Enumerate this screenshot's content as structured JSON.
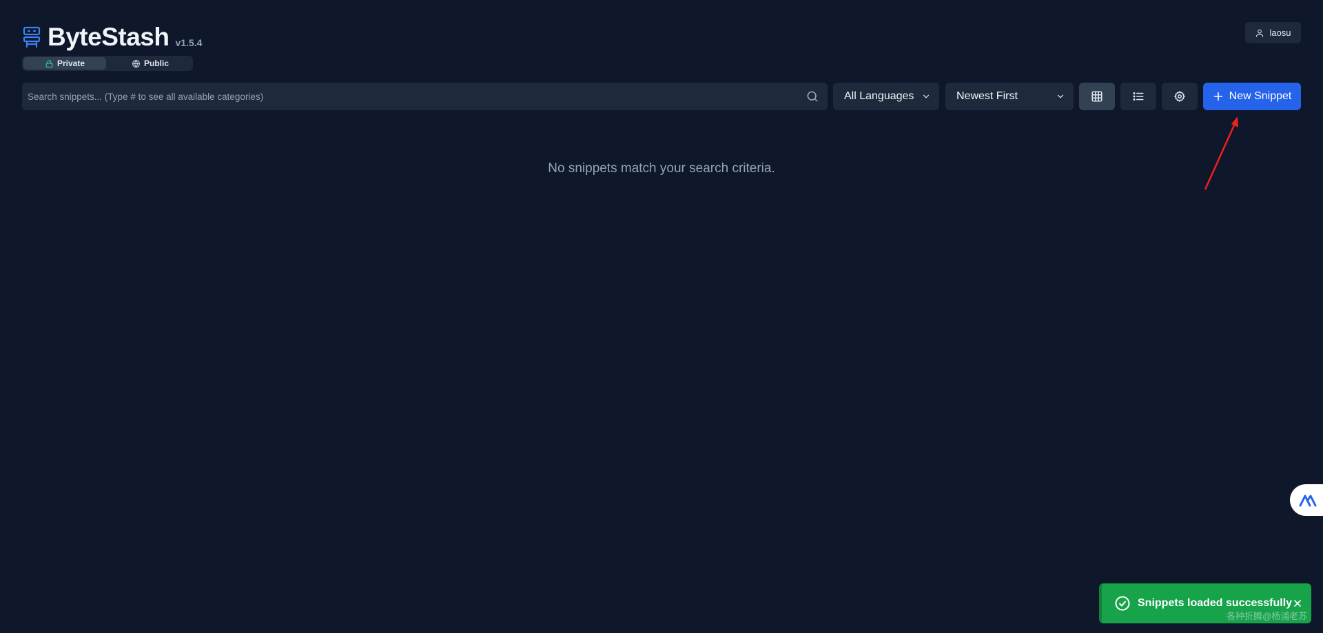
{
  "app": {
    "title": "ByteStash",
    "version": "v1.5.4",
    "brand_color": "#3b82f6",
    "logo_icon": "archive-box-icon"
  },
  "visibility": {
    "tabs": [
      {
        "label": "Private",
        "icon": "lock-icon",
        "active": true
      },
      {
        "label": "Public",
        "icon": "globe-icon",
        "active": false
      }
    ]
  },
  "user": {
    "name": "laosu",
    "icon": "user-icon"
  },
  "toolbar": {
    "search_placeholder": "Search snippets... (Type # to see all available categories)",
    "language_filter": "All Languages",
    "sort_order": "Newest First",
    "view_modes": [
      "grid",
      "list"
    ],
    "active_view": "grid",
    "new_snippet_label": "New Snippet",
    "accent_color": "#2563eb"
  },
  "main": {
    "empty_message": "No snippets match your search criteria."
  },
  "toast": {
    "message": "Snippets loaded successfully",
    "status": "success",
    "color": "#16a34a"
  },
  "watermark": "各种折腾@杨浦老苏"
}
